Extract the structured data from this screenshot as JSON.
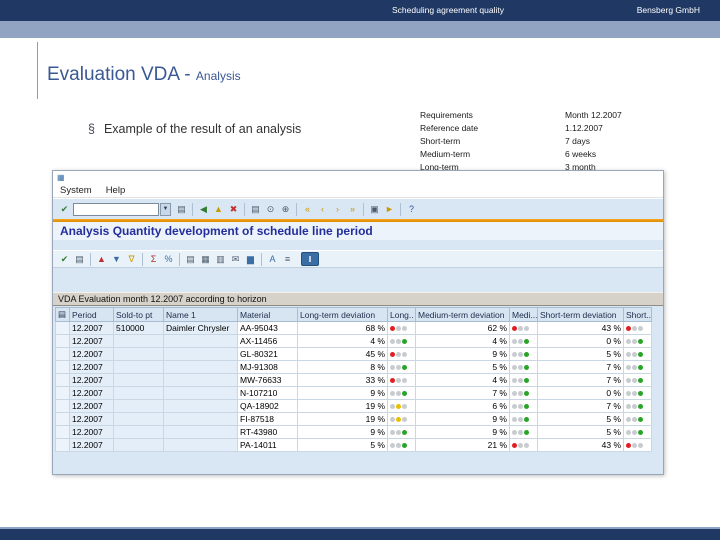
{
  "slide": {
    "header": {
      "title": "Scheduling agreement quality",
      "company": "Bensberg GmbH"
    },
    "title_main": "Evaluation VDA - ",
    "title_sub": "Analysis",
    "bullet_marker": "§",
    "bullet_text": "Example of the result of an analysis",
    "params": {
      "labels": [
        "Requirements",
        "Reference date",
        "Short-term",
        "Medium-term",
        "Long-term"
      ],
      "values": [
        "Month 12.2007",
        "1.12.2007",
        "7 days",
        "6 weeks",
        "3 month"
      ]
    }
  },
  "sap": {
    "window_icon": "▦",
    "menu_items": [
      "System",
      "Help"
    ],
    "command_value": "",
    "dropdown_glyph": "▼",
    "screen_title": "Analysis Quantity development of schedule line period",
    "variant_text": "VDA Evaluation month 12.2007 according to horizon",
    "stop_button_glyph": "‖",
    "std_toolbar_left": [
      {
        "name": "enter-icon",
        "glyph": "✔",
        "color": "#2E7D32"
      }
    ],
    "std_toolbar_right": [
      {
        "name": "save-icon",
        "glyph": "▤",
        "color": "#4A5A6A"
      },
      {
        "type": "sep"
      },
      {
        "name": "back-icon",
        "glyph": "◀",
        "color": "#2E7D32"
      },
      {
        "name": "exit-icon",
        "glyph": "▲",
        "color": "#C89B00"
      },
      {
        "name": "cancel-icon",
        "glyph": "✖",
        "color": "#C03030"
      },
      {
        "type": "sep"
      },
      {
        "name": "print-icon",
        "glyph": "▤",
        "color": "#4A5A6A"
      },
      {
        "name": "find-icon",
        "glyph": "⊙",
        "color": "#4A5A6A"
      },
      {
        "name": "find-next-icon",
        "glyph": "⊕",
        "color": "#4A5A6A"
      },
      {
        "type": "sep"
      },
      {
        "name": "first-page-icon",
        "glyph": "«",
        "color": "#C89B00"
      },
      {
        "name": "previous-page-icon",
        "glyph": "‹",
        "color": "#C89B00"
      },
      {
        "name": "next-page-icon",
        "glyph": "›",
        "color": "#C89B00"
      },
      {
        "name": "last-page-icon",
        "glyph": "»",
        "color": "#C89B00"
      },
      {
        "type": "sep"
      },
      {
        "name": "new-session-icon",
        "glyph": "▣",
        "color": "#4A5A6A"
      },
      {
        "name": "create-shortcut-icon",
        "glyph": "►",
        "color": "#C89B00"
      },
      {
        "type": "sep"
      },
      {
        "name": "help-icon",
        "glyph": "?",
        "color": "#2E5AA0"
      }
    ],
    "app_toolbar": [
      {
        "name": "pick-icon",
        "glyph": "✔",
        "color": "#2E7D32"
      },
      {
        "name": "save-list-icon",
        "glyph": "▤",
        "color": "#4A5A6A"
      },
      {
        "type": "sep"
      },
      {
        "name": "sort-ascending-icon",
        "glyph": "▲",
        "color": "#C03030"
      },
      {
        "name": "sort-descending-icon",
        "glyph": "▼",
        "color": "#3A6EA5"
      },
      {
        "name": "filter-icon",
        "glyph": "∇",
        "color": "#C89B00"
      },
      {
        "type": "sep"
      },
      {
        "name": "total-icon",
        "glyph": "Σ",
        "color": "#B03030"
      },
      {
        "name": "subtotal-icon",
        "glyph": "%",
        "color": "#3A6EA5"
      },
      {
        "type": "sep"
      },
      {
        "name": "print-list-icon",
        "glyph": "▤",
        "color": "#4A5A6A"
      },
      {
        "name": "export-icon",
        "glyph": "▦",
        "color": "#4A5A6A"
      },
      {
        "name": "local-file-icon",
        "glyph": "▥",
        "color": "#4A5A6A"
      },
      {
        "name": "mail-icon",
        "glyph": "✉",
        "color": "#4A5A6A"
      },
      {
        "name": "graphic-icon",
        "glyph": "▆",
        "color": "#3A6EA5"
      },
      {
        "type": "sep"
      },
      {
        "name": "abc-analysis-icon",
        "glyph": "A",
        "color": "#3A6EA5"
      },
      {
        "name": "layout-icon",
        "glyph": "≡",
        "color": "#4A5A6A"
      }
    ],
    "table": {
      "corner_glyph": "▤",
      "headers": [
        "Period",
        "Sold-to pt",
        "Name 1",
        "Material",
        "Long-term deviation",
        "Long..",
        "Medium-term deviation",
        "Medi...",
        "Short-term deviation",
        "Short..."
      ],
      "rows": [
        {
          "period": "12.2007",
          "sold_to": "510000",
          "name": "Daimler Chrysler",
          "material": "AA-95043",
          "long": "68 %",
          "long_status": "red",
          "medium": "62 %",
          "medium_status": "red",
          "short": "43 %",
          "short_status": "red"
        },
        {
          "period": "12.2007",
          "sold_to": "",
          "name": "",
          "material": "AX-11456",
          "long": "4 %",
          "long_status": "green",
          "medium": "4 %",
          "medium_status": "green",
          "short": "0 %",
          "short_status": "green"
        },
        {
          "period": "12.2007",
          "sold_to": "",
          "name": "",
          "material": "GL-80321",
          "long": "45 %",
          "long_status": "red",
          "medium": "9 %",
          "medium_status": "green",
          "short": "5 %",
          "short_status": "green"
        },
        {
          "period": "12.2007",
          "sold_to": "",
          "name": "",
          "material": "MJ-91308",
          "long": "8 %",
          "long_status": "green",
          "medium": "5 %",
          "medium_status": "green",
          "short": "7 %",
          "short_status": "green"
        },
        {
          "period": "12.2007",
          "sold_to": "",
          "name": "",
          "material": "MW-76633",
          "long": "33 %",
          "long_status": "red",
          "medium": "4 %",
          "medium_status": "green",
          "short": "7 %",
          "short_status": "green"
        },
        {
          "period": "12.2007",
          "sold_to": "",
          "name": "",
          "material": "N-107210",
          "long": "9 %",
          "long_status": "green",
          "medium": "7 %",
          "medium_status": "green",
          "short": "0 %",
          "short_status": "green"
        },
        {
          "period": "12.2007",
          "sold_to": "",
          "name": "",
          "material": "QA-18902",
          "long": "19 %",
          "long_status": "yellow",
          "medium": "6 %",
          "medium_status": "green",
          "short": "7 %",
          "short_status": "green"
        },
        {
          "period": "12.2007",
          "sold_to": "",
          "name": "",
          "material": "FI-87518",
          "long": "19 %",
          "long_status": "yellow",
          "medium": "9 %",
          "medium_status": "green",
          "short": "5 %",
          "short_status": "green"
        },
        {
          "period": "12.2007",
          "sold_to": "",
          "name": "",
          "material": "RT-43980",
          "long": "9 %",
          "long_status": "green",
          "medium": "9 %",
          "medium_status": "green",
          "short": "5 %",
          "short_status": "green"
        },
        {
          "period": "12.2007",
          "sold_to": "",
          "name": "",
          "material": "PA-14011",
          "long": "5 %",
          "long_status": "green",
          "medium": "21 %",
          "medium_status": "red",
          "short": "43 %",
          "short_status": "red"
        }
      ]
    }
  },
  "colors": {
    "navy": "#203864",
    "sub_bar_blue": "#91A5C2",
    "accent_orange": "#E88D00",
    "status_red": "#E02020",
    "status_yellow": "#E8C000",
    "status_green": "#28A428"
  }
}
